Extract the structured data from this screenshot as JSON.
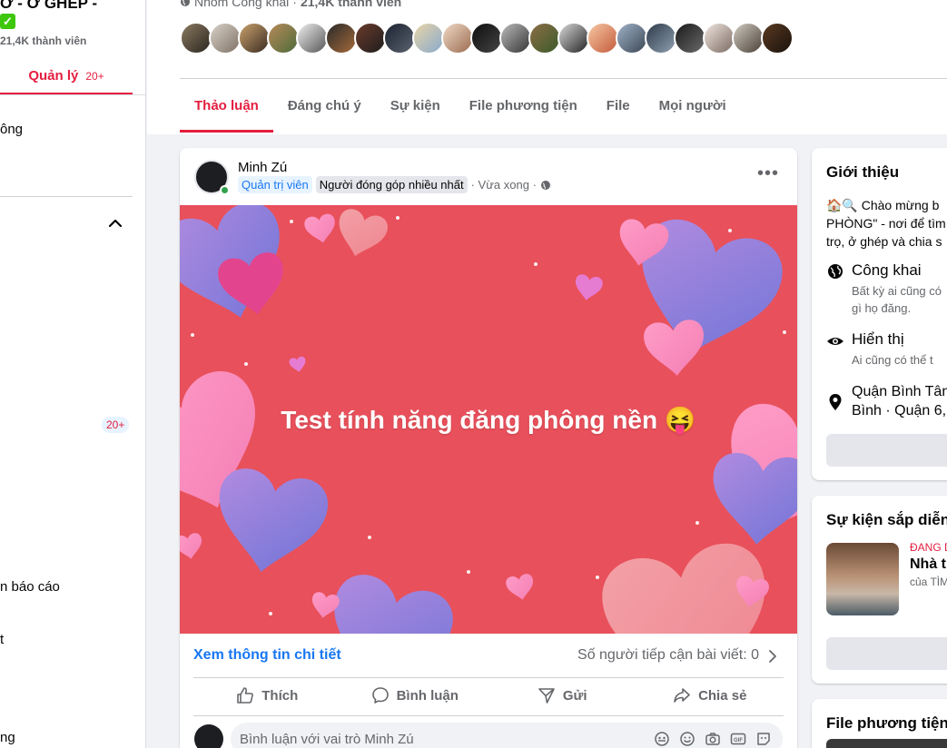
{
  "sidebar": {
    "group_title": "Ở - Ở GHÉP -",
    "members": "21,4K thành viên",
    "manage_label": "Quản lý",
    "manage_count": "20+",
    "items": [
      {
        "label": "ông"
      },
      {
        "label": "n báo cáo"
      },
      {
        "label": "t"
      },
      {
        "label": "ng"
      }
    ],
    "badge": "20+"
  },
  "header": {
    "privacy": "Nhóm Công khai",
    "members": "21,4K thành viên",
    "tabs": [
      {
        "label": "Thảo luận"
      },
      {
        "label": "Đáng chú ý"
      },
      {
        "label": "Sự kiện"
      },
      {
        "label": "File phương tiện"
      },
      {
        "label": "File"
      },
      {
        "label": "Mọi người"
      }
    ]
  },
  "post": {
    "author": "Minh Zú",
    "role_admin": "Quản trị viên",
    "role_contributor": "Người đóng góp nhiều nhất",
    "time": "· Vừa xong ·",
    "text": "Test tính năng đăng phông nền 😝",
    "insight_link": "Xem thông tin chi tiết",
    "reach": "Số người tiếp cận bài viết: 0",
    "actions": {
      "like": "Thích",
      "comment": "Bình luận",
      "send": "Gửi",
      "share": "Chia sẻ"
    },
    "comment_placeholder": "Bình luận với vai trò Minh Zú"
  },
  "about": {
    "title": "Giới thiệu",
    "intro_lines": [
      "🏠🔍 Chào mừng b",
      "PHÒNG\" - nơi để tìm",
      "trọ, ở ghép và chia s"
    ],
    "public_title": "Công khai",
    "public_desc": [
      "Bất kỳ ai cũng có",
      "gì họ đăng."
    ],
    "visible_title": "Hiển thị",
    "visible_desc": "Ai cũng có thể t",
    "location_lines": [
      "Quận Bình Tân",
      "Bình · Quận 6,"
    ]
  },
  "events": {
    "title": "Sự kiện sắp diễn r",
    "live": "ĐANG D",
    "name": "Nhà t",
    "by": "của TÌM"
  },
  "media": {
    "title": "File phương tiện n"
  },
  "colors": {
    "accent": "#e41e3f",
    "link": "#1877f2",
    "post_bg": "#e8505b"
  }
}
